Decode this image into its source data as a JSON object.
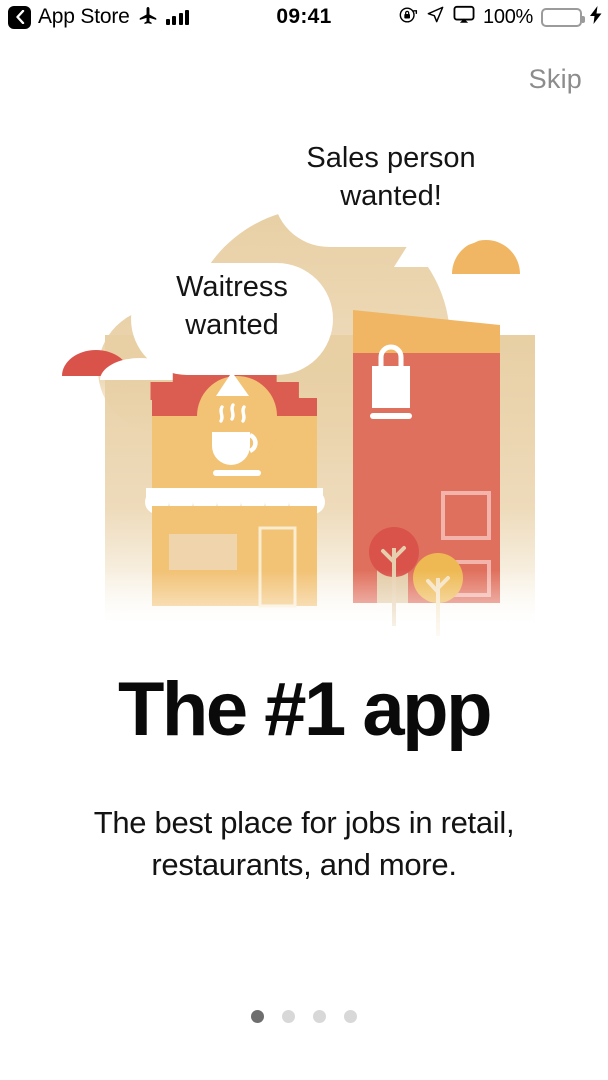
{
  "status_bar": {
    "back_icon": "back-chevron-icon",
    "app_name": "App Store",
    "airplane_icon": "airplane-mode-icon",
    "signal_icon": "cellular-signal-icon",
    "time": "09:41",
    "rotation_lock_icon": "rotation-lock-icon",
    "location_icon": "location-arrow-icon",
    "airplay_icon": "screen-mirroring-icon",
    "battery_percent": "100%",
    "battery_icon": "battery-icon",
    "charging_icon": "lightning-bolt-icon",
    "battery_color": "#4cd964"
  },
  "header": {
    "skip_label": "Skip"
  },
  "illustration": {
    "name": "onboarding-storefront-illustration",
    "bubbles": [
      {
        "id": "sales-bubble",
        "line1": "Sales person",
        "line2": "wanted!"
      },
      {
        "id": "waitress-bubble",
        "line1": "Waitress",
        "line2": "wanted"
      }
    ],
    "cafe": {
      "name": "cafe-building",
      "sign_icon": "coffee-cup-icon"
    },
    "shop": {
      "name": "shop-building",
      "sign_icon": "shopping-bag-icon"
    },
    "trees": [
      "red-tree",
      "yellow-tree"
    ],
    "colors": {
      "backdrop": "#e8cfa4",
      "cafe_body": "#f2c275",
      "cafe_roof": "#db5d52",
      "shop_body": "#e0705e",
      "shop_roof": "#f0b663",
      "cream": "#ecd6b0",
      "white": "#ffffff",
      "tree_red": "#d9534b",
      "tree_yellow": "#eeb953"
    }
  },
  "main": {
    "headline": "The #1 app",
    "subtitle_line1": "The best place for jobs in retail,",
    "subtitle_line2": "restaurants, and more."
  },
  "pagination": {
    "total": 4,
    "active_index": 0,
    "active_color": "#6e6e6e",
    "inactive_color": "#d8d8d8"
  }
}
